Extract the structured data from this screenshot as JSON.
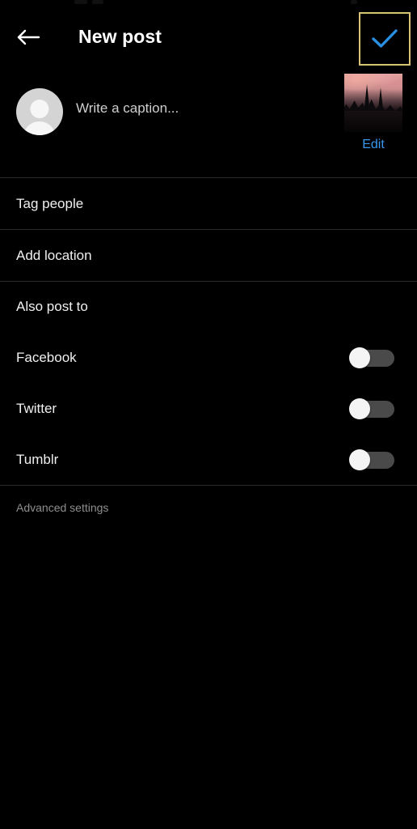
{
  "app": {
    "screen_title": "New post",
    "background_color": "#000000",
    "accent_color": "#3897f0",
    "highlight_border_color": "#d8c273"
  },
  "header": {
    "back_icon": "arrow-left-icon",
    "title": "New post",
    "confirm_icon": "check-icon",
    "confirm_icon_color": "#2a8fe0",
    "confirm_highlighted": true
  },
  "caption": {
    "avatar_icon": "default-avatar-icon",
    "placeholder": "Write a caption...",
    "value": "",
    "thumbnail_alt": "selected-photo-thumbnail",
    "edit_label": "Edit"
  },
  "options": [
    {
      "label": "Tag people",
      "name": "tag-people"
    },
    {
      "label": "Add location",
      "name": "add-location"
    }
  ],
  "also_post_to": {
    "heading": "Also post to",
    "services": [
      {
        "label": "Facebook",
        "name": "facebook",
        "enabled": false
      },
      {
        "label": "Twitter",
        "name": "twitter",
        "enabled": false
      },
      {
        "label": "Tumblr",
        "name": "tumblr",
        "enabled": false
      }
    ]
  },
  "advanced": {
    "label": "Advanced settings"
  }
}
